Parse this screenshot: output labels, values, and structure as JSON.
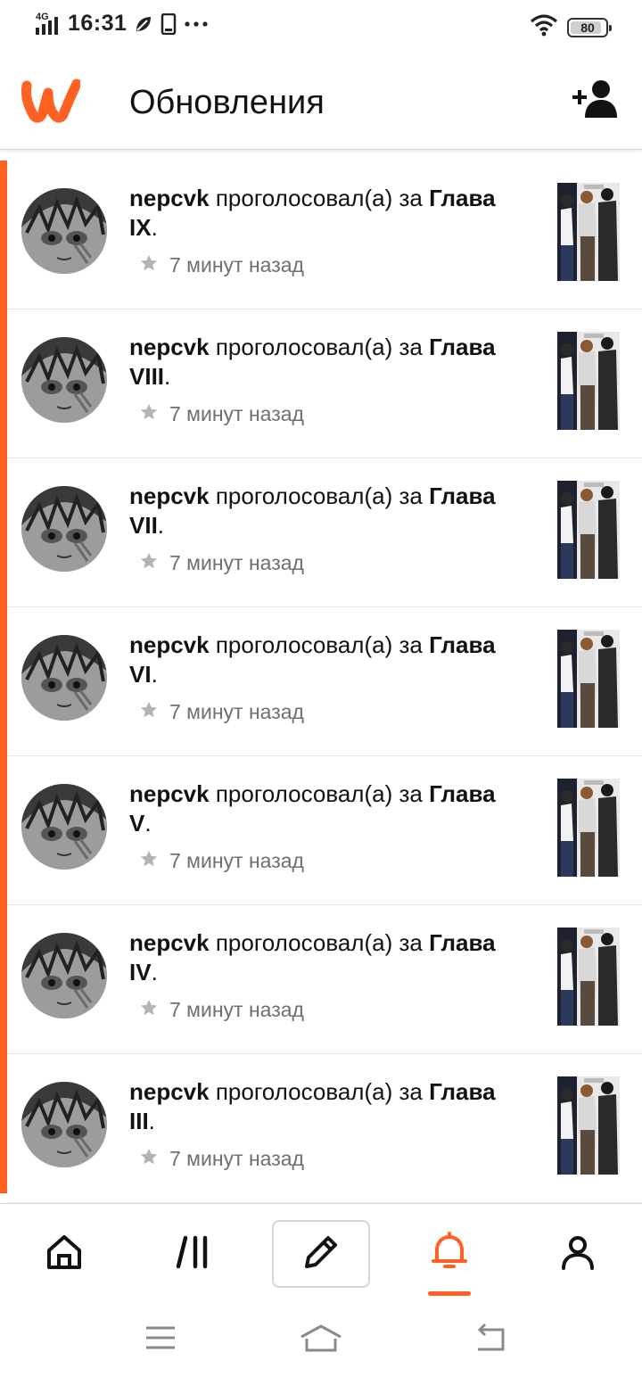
{
  "status_bar": {
    "network": "4G",
    "time": "16:31",
    "battery": "80"
  },
  "header": {
    "title": "Обновления",
    "logo_icon": "wattpad-logo",
    "right_icon": "add-user-icon"
  },
  "colors": {
    "accent": "#ff6122",
    "text": "#121212",
    "muted": "#6f6f6f",
    "star": "#b3b3b3"
  },
  "notifications": [
    {
      "user": "nepcvk",
      "action": "проголосовал(а) за",
      "chapter": "Глава IX",
      "end": ".",
      "time": "7 минут назад"
    },
    {
      "user": "nepcvk",
      "action": "проголосовал(а) за",
      "chapter": "Глава VIII",
      "end": ".",
      "time": "7 минут назад"
    },
    {
      "user": "nepcvk",
      "action": "проголосовал(а) за",
      "chapter": "Глава VII",
      "end": ".",
      "time": "7 минут назад"
    },
    {
      "user": "nepcvk",
      "action": "проголосовал(а) за",
      "chapter": "Глава VI",
      "end": ".",
      "time": "7 минут назад"
    },
    {
      "user": "nepcvk",
      "action": "проголосовал(а) за",
      "chapter": "Глава V",
      "end": ".",
      "time": "7 минут назад"
    },
    {
      "user": "nepcvk",
      "action": "проголосовал(а) за",
      "chapter": "Глава IV",
      "end": ".",
      "time": "7 минут назад"
    },
    {
      "user": "nepcvk",
      "action": "проголосовал(а) за",
      "chapter": "Глава III",
      "end": ".",
      "time": "7 минут назад"
    }
  ],
  "bottom_nav": {
    "items": [
      "home-icon",
      "library-icon",
      "write-icon",
      "notifications-icon",
      "profile-icon"
    ],
    "active": "notifications-icon"
  },
  "system_nav": [
    "menu-icon",
    "home-icon",
    "back-icon"
  ]
}
